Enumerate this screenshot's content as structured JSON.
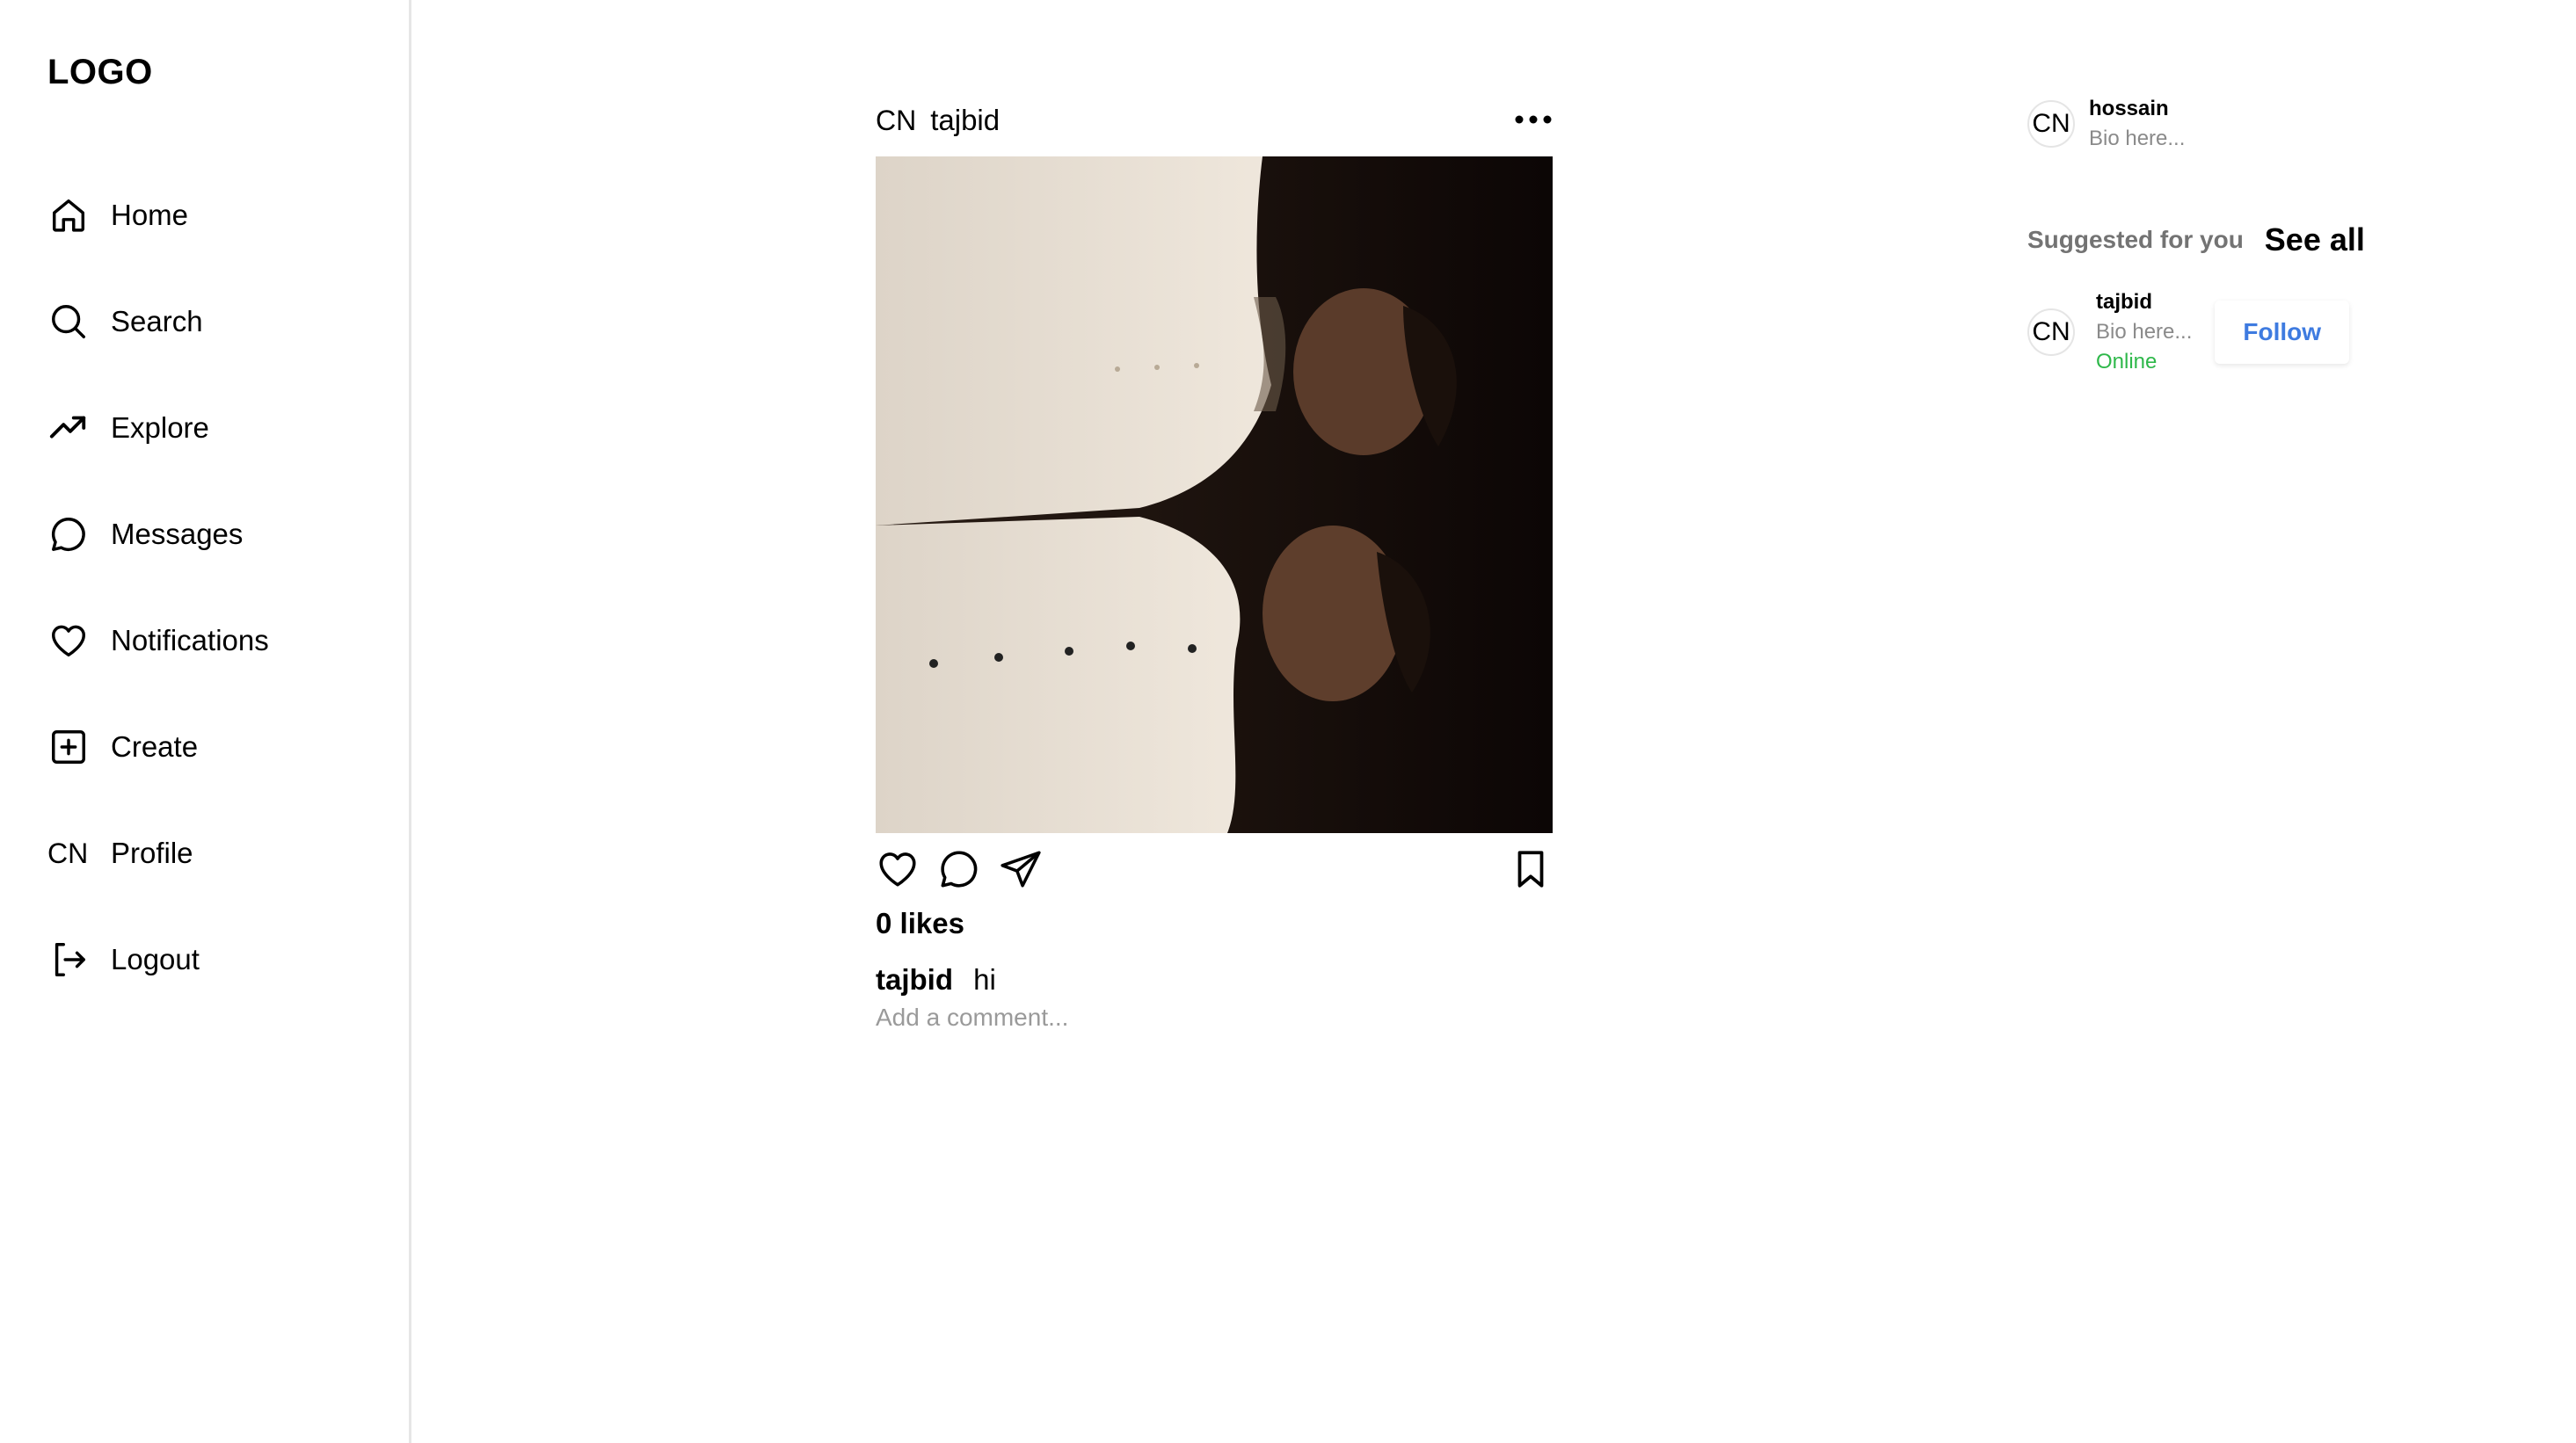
{
  "sidebar": {
    "logo": "LOGO",
    "items": [
      {
        "label": "Home",
        "icon": "home-icon"
      },
      {
        "label": "Search",
        "icon": "search-icon"
      },
      {
        "label": "Explore",
        "icon": "trending-up-icon"
      },
      {
        "label": "Messages",
        "icon": "message-icon"
      },
      {
        "label": "Notifications",
        "icon": "heart-icon"
      },
      {
        "label": "Create",
        "icon": "plus-square-icon"
      },
      {
        "label": "Profile",
        "icon_text": "CN"
      },
      {
        "label": "Logout",
        "icon": "logout-icon"
      }
    ]
  },
  "post": {
    "avatar_text": "CN",
    "username": "tajbid",
    "likes": "0 likes",
    "caption_user": "tajbid",
    "caption_text": "hi",
    "comment_placeholder": "Add a comment..."
  },
  "right_panel": {
    "current_user": {
      "avatar_text": "CN",
      "username": "hossain",
      "bio": "Bio here..."
    },
    "suggested_title": "Suggested for you",
    "see_all": "See all",
    "suggestions": [
      {
        "avatar_text": "CN",
        "username": "tajbid",
        "bio": "Bio here...",
        "status": "Online",
        "action": "Follow"
      }
    ]
  },
  "colors": {
    "follow": "#3e7be0",
    "online": "#2eb84a",
    "muted": "#8a8a8a"
  }
}
